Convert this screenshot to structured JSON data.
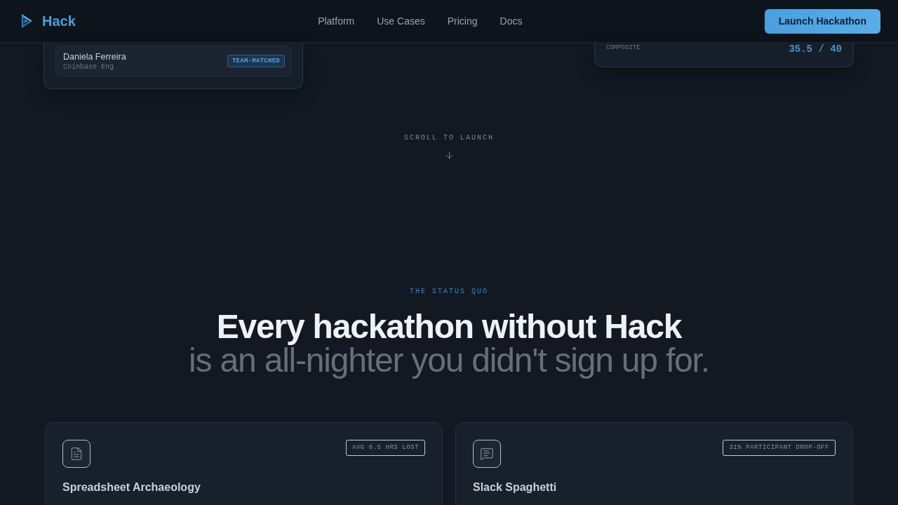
{
  "header": {
    "brand": "Hack",
    "nav": [
      "Platform",
      "Use Cases",
      "Pricing",
      "Docs"
    ],
    "cta": "Launch Hackathon"
  },
  "hero_cards": {
    "match_card": {
      "name": "Daniela Ferreira",
      "org": "Coinbase Eng",
      "badge": "TEAM-MATCHED"
    },
    "score_card": {
      "label": "COMPOSITE",
      "value": "35.5 / 40"
    }
  },
  "scroll_hint": {
    "label": "SCROLL TO LAUNCH"
  },
  "status_quo": {
    "eyebrow": "THE STATUS QUO",
    "headline": "Every hackathon without Hack",
    "subheadline": "is an all-nighter you didn't sign up for.",
    "cards": [
      {
        "kind": "document",
        "title": "Spreadsheet Archaeology",
        "stat": "AVG 6.5 HRS LOST"
      },
      {
        "kind": "chat",
        "title": "Slack Spaghetti",
        "stat": "31% PARTICIPANT DROP-OFF"
      }
    ]
  }
}
